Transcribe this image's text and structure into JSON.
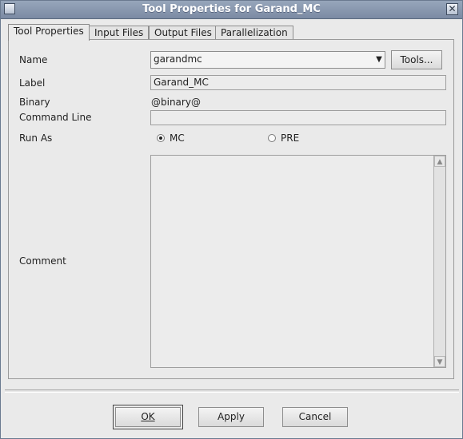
{
  "window": {
    "title": "Tool Properties for Garand_MC"
  },
  "tabs": [
    {
      "label": "Tool Properties",
      "active": true
    },
    {
      "label": "Input Files",
      "active": false
    },
    {
      "label": "Output Files",
      "active": false
    },
    {
      "label": "Parallelization",
      "active": false
    }
  ],
  "form": {
    "name": {
      "label": "Name",
      "value": "garandmc",
      "tools_button": "Tools..."
    },
    "label": {
      "label": "Label",
      "value": "Garand_MC"
    },
    "binary": {
      "label": "Binary",
      "value": "@binary@"
    },
    "command_line": {
      "label": "Command Line",
      "value": ""
    },
    "run_as": {
      "label": "Run As",
      "options": [
        {
          "label": "MC",
          "selected": true
        },
        {
          "label": "PRE",
          "selected": false
        }
      ]
    },
    "comment": {
      "label": "Comment",
      "value": ""
    }
  },
  "buttons": {
    "ok": "OK",
    "apply": "Apply",
    "cancel": "Cancel"
  },
  "icons": {
    "window_menu": "window-menu-icon",
    "close": "close-icon",
    "combo_arrow": "triangle-down-icon",
    "scroll_up": "triangle-up-icon",
    "scroll_down": "triangle-down-icon"
  }
}
